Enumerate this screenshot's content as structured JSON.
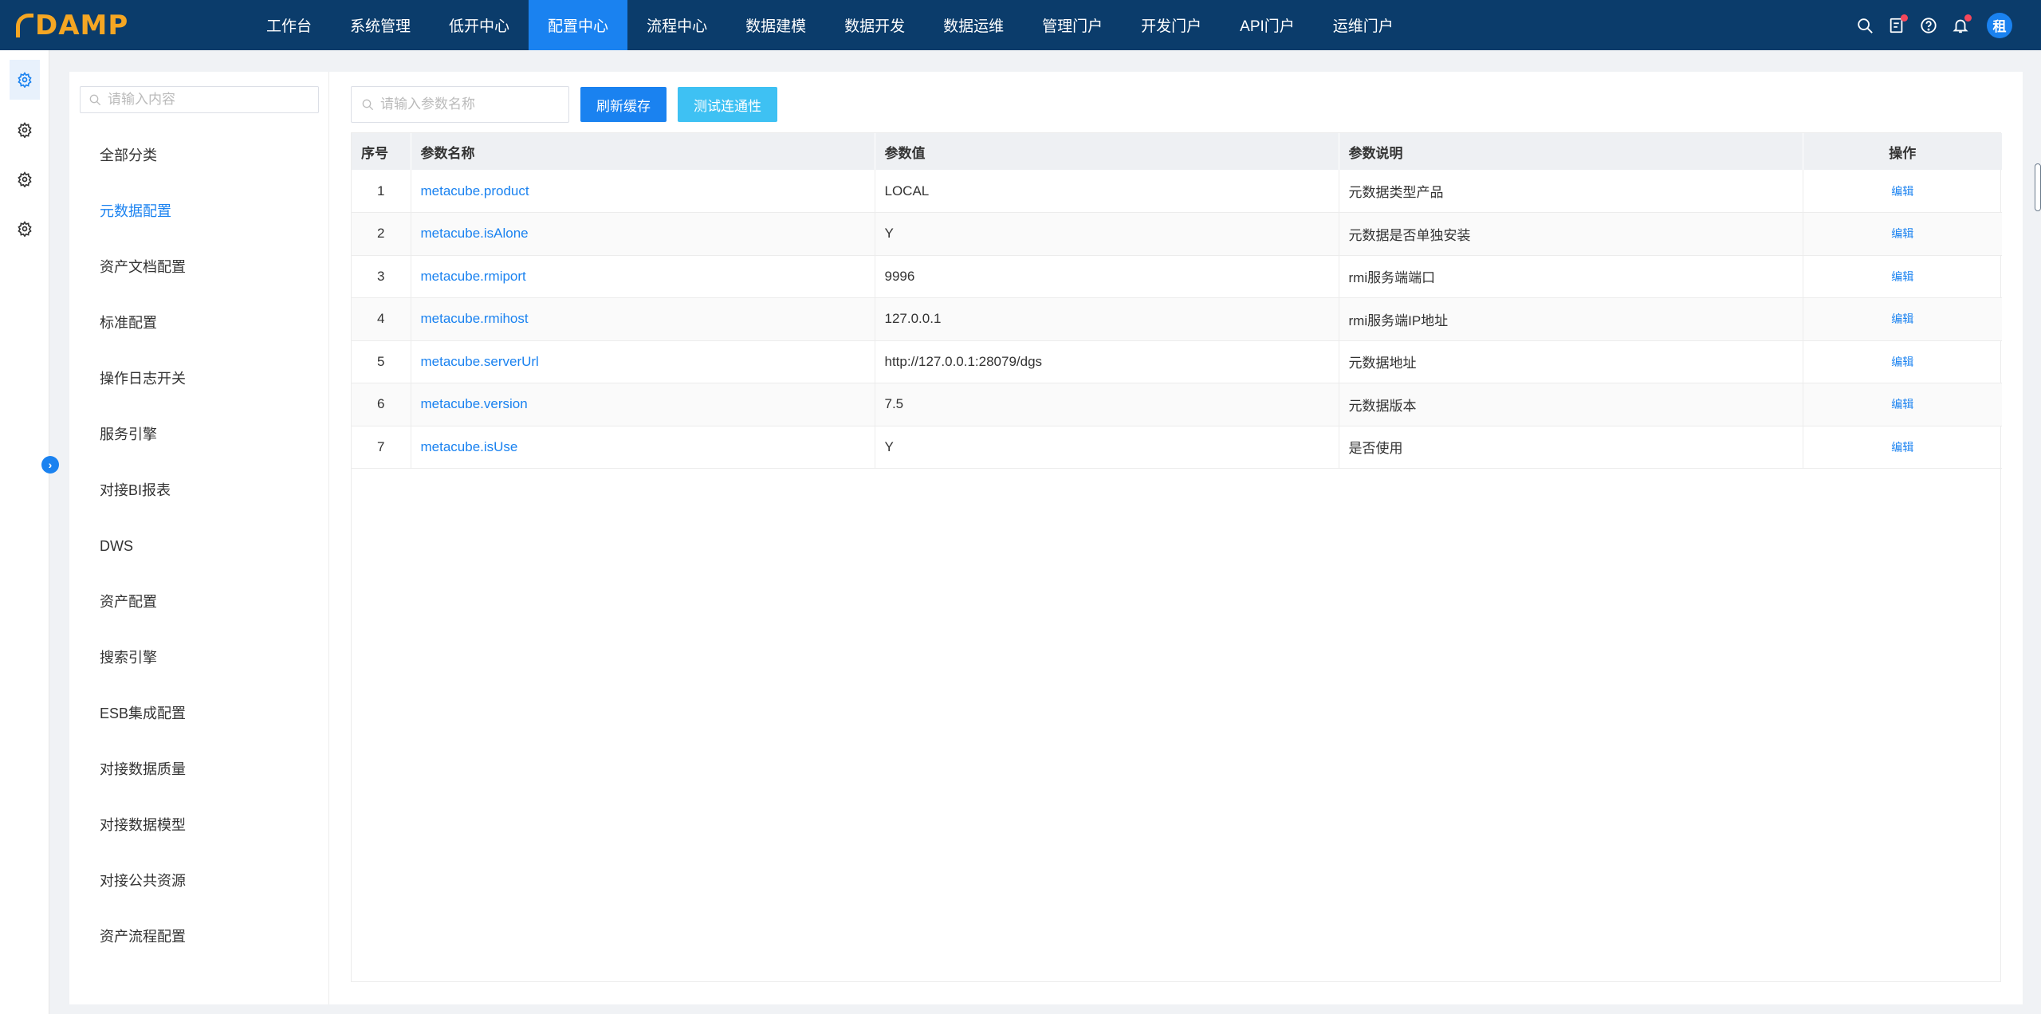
{
  "app": {
    "logo_text": "DAMP"
  },
  "nav": {
    "items": [
      "工作台",
      "系统管理",
      "低开中心",
      "配置中心",
      "流程中心",
      "数据建模",
      "数据开发",
      "数据运维",
      "管理门户",
      "开发门户",
      "API门户",
      "运维门户"
    ],
    "active_index": 3
  },
  "user": {
    "avatar_text": "租"
  },
  "rail": {
    "icons": [
      "gear-icon",
      "gear-icon",
      "gear-icon",
      "gear-icon"
    ]
  },
  "category": {
    "search_placeholder": "请输入内容",
    "items": [
      "全部分类",
      "元数据配置",
      "资产文档配置",
      "标准配置",
      "操作日志开关",
      "服务引擎",
      "对接BI报表",
      "DWS",
      "资产配置",
      "搜索引擎",
      "ESB集成配置",
      "对接数据质量",
      "对接数据模型",
      "对接公共资源",
      "资产流程配置"
    ],
    "active_index": 1
  },
  "toolbar": {
    "search_placeholder": "请输入参数名称",
    "refresh_label": "刷新缓存",
    "test_label": "测试连通性"
  },
  "table": {
    "headers": [
      "序号",
      "参数名称",
      "参数值",
      "参数说明",
      "操作"
    ],
    "rows": [
      {
        "no": "1",
        "name": "metacube.product",
        "value": "LOCAL",
        "desc": "元数据类型产品",
        "action": "编辑"
      },
      {
        "no": "2",
        "name": "metacube.isAlone",
        "value": "Y",
        "desc": "元数据是否单独安装",
        "action": "编辑"
      },
      {
        "no": "3",
        "name": "metacube.rmiport",
        "value": "9996",
        "desc": "rmi服务端端口",
        "action": "编辑"
      },
      {
        "no": "4",
        "name": "metacube.rmihost",
        "value": "127.0.0.1",
        "desc": "rmi服务端IP地址",
        "action": "编辑"
      },
      {
        "no": "5",
        "name": "metacube.serverUrl",
        "value": "http://127.0.0.1:28079/dgs",
        "desc": "元数据地址",
        "action": "编辑"
      },
      {
        "no": "6",
        "name": "metacube.version",
        "value": "7.5",
        "desc": "元数据版本",
        "action": "编辑"
      },
      {
        "no": "7",
        "name": "metacube.isUse",
        "value": "Y",
        "desc": "是否使用",
        "action": "编辑"
      }
    ]
  },
  "colors": {
    "topbar": "#0b3c6b",
    "accent": "#1a82f0",
    "cyan": "#3ec1f3",
    "logo": "#f5a623"
  }
}
